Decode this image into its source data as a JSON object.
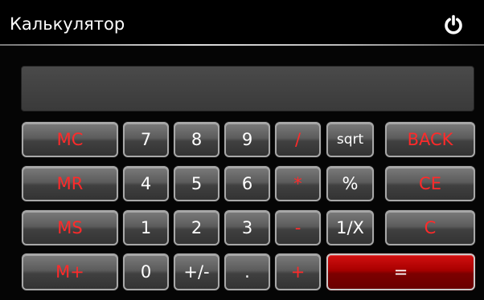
{
  "app": {
    "title": "Калькулятор",
    "power_icon": "power-icon",
    "accent_color": "#c00000"
  },
  "display": {
    "value": ""
  },
  "keys": {
    "mc": "MC",
    "mr": "MR",
    "ms": "MS",
    "mplus": "M+",
    "d7": "7",
    "d8": "8",
    "d9": "9",
    "d4": "4",
    "d5": "5",
    "d6": "6",
    "d1": "1",
    "d2": "2",
    "d3": "3",
    "d0": "0",
    "plusminus": "+/-",
    "dot": ".",
    "divide": "/",
    "multiply": "*",
    "minus": "-",
    "plus": "+",
    "sqrt": "sqrt",
    "percent": "%",
    "reciprocal": "1/X",
    "back": "BACK",
    "ce": "CE",
    "c": "C",
    "equals": "="
  }
}
